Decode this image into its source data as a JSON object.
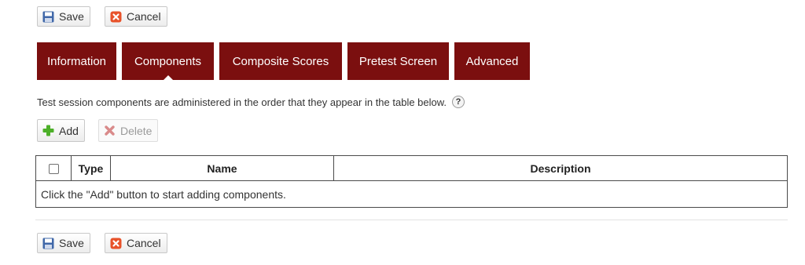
{
  "toolbar_top": {
    "save_label": "Save",
    "cancel_label": "Cancel"
  },
  "tabs": [
    {
      "label": "Information",
      "active": false
    },
    {
      "label": "Components",
      "active": true
    },
    {
      "label": "Composite Scores",
      "active": false
    },
    {
      "label": "Pretest Screen",
      "active": false
    },
    {
      "label": "Advanced",
      "active": false
    }
  ],
  "info_text": "Test session components are administered in the order that they appear in the table below.",
  "help_glyph": "?",
  "actions": {
    "add_label": "Add",
    "delete_label": "Delete",
    "delete_enabled": false
  },
  "table": {
    "columns": [
      "",
      "Type",
      "Name",
      "Description"
    ],
    "empty_message": "Click the \"Add\" button to start adding components."
  },
  "toolbar_bottom": {
    "save_label": "Save",
    "cancel_label": "Cancel"
  },
  "colors": {
    "tab_bg": "#7b0f0f",
    "tab_text": "#ffffff",
    "save_icon": "#3f67a8",
    "cancel_icon": "#e8522a",
    "add_icon": "#4caf28",
    "delete_icon": "#d98a8a"
  },
  "icons": {
    "save": "floppy-disk-icon",
    "cancel": "cancel-x-icon",
    "add": "plus-icon",
    "delete": "delete-x-icon",
    "help": "question-circle-icon"
  }
}
